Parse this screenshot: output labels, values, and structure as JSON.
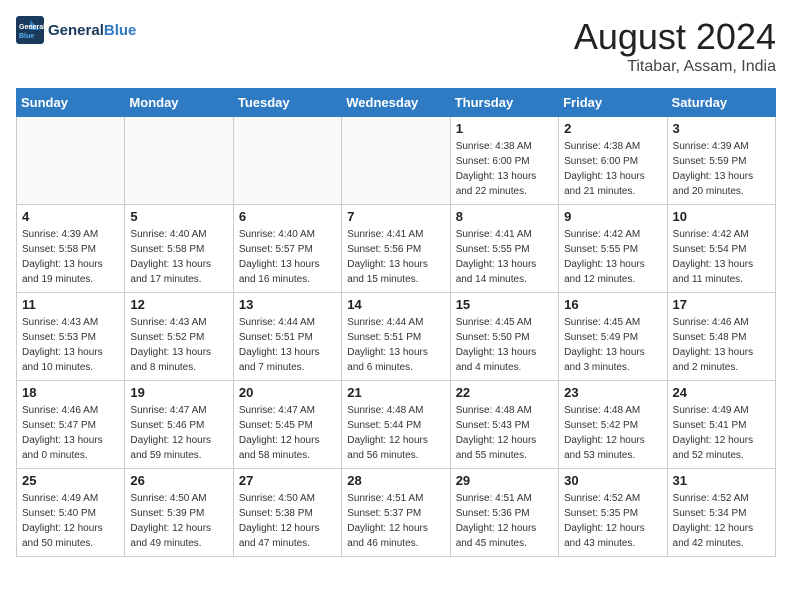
{
  "logo": {
    "line1": "General",
    "line2": "Blue"
  },
  "title": "August 2024",
  "location": "Titabar, Assam, India",
  "headers": [
    "Sunday",
    "Monday",
    "Tuesday",
    "Wednesday",
    "Thursday",
    "Friday",
    "Saturday"
  ],
  "weeks": [
    [
      {
        "day": "",
        "info": ""
      },
      {
        "day": "",
        "info": ""
      },
      {
        "day": "",
        "info": ""
      },
      {
        "day": "",
        "info": ""
      },
      {
        "day": "1",
        "info": "Sunrise: 4:38 AM\nSunset: 6:00 PM\nDaylight: 13 hours\nand 22 minutes."
      },
      {
        "day": "2",
        "info": "Sunrise: 4:38 AM\nSunset: 6:00 PM\nDaylight: 13 hours\nand 21 minutes."
      },
      {
        "day": "3",
        "info": "Sunrise: 4:39 AM\nSunset: 5:59 PM\nDaylight: 13 hours\nand 20 minutes."
      }
    ],
    [
      {
        "day": "4",
        "info": "Sunrise: 4:39 AM\nSunset: 5:58 PM\nDaylight: 13 hours\nand 19 minutes."
      },
      {
        "day": "5",
        "info": "Sunrise: 4:40 AM\nSunset: 5:58 PM\nDaylight: 13 hours\nand 17 minutes."
      },
      {
        "day": "6",
        "info": "Sunrise: 4:40 AM\nSunset: 5:57 PM\nDaylight: 13 hours\nand 16 minutes."
      },
      {
        "day": "7",
        "info": "Sunrise: 4:41 AM\nSunset: 5:56 PM\nDaylight: 13 hours\nand 15 minutes."
      },
      {
        "day": "8",
        "info": "Sunrise: 4:41 AM\nSunset: 5:55 PM\nDaylight: 13 hours\nand 14 minutes."
      },
      {
        "day": "9",
        "info": "Sunrise: 4:42 AM\nSunset: 5:55 PM\nDaylight: 13 hours\nand 12 minutes."
      },
      {
        "day": "10",
        "info": "Sunrise: 4:42 AM\nSunset: 5:54 PM\nDaylight: 13 hours\nand 11 minutes."
      }
    ],
    [
      {
        "day": "11",
        "info": "Sunrise: 4:43 AM\nSunset: 5:53 PM\nDaylight: 13 hours\nand 10 minutes."
      },
      {
        "day": "12",
        "info": "Sunrise: 4:43 AM\nSunset: 5:52 PM\nDaylight: 13 hours\nand 8 minutes."
      },
      {
        "day": "13",
        "info": "Sunrise: 4:44 AM\nSunset: 5:51 PM\nDaylight: 13 hours\nand 7 minutes."
      },
      {
        "day": "14",
        "info": "Sunrise: 4:44 AM\nSunset: 5:51 PM\nDaylight: 13 hours\nand 6 minutes."
      },
      {
        "day": "15",
        "info": "Sunrise: 4:45 AM\nSunset: 5:50 PM\nDaylight: 13 hours\nand 4 minutes."
      },
      {
        "day": "16",
        "info": "Sunrise: 4:45 AM\nSunset: 5:49 PM\nDaylight: 13 hours\nand 3 minutes."
      },
      {
        "day": "17",
        "info": "Sunrise: 4:46 AM\nSunset: 5:48 PM\nDaylight: 13 hours\nand 2 minutes."
      }
    ],
    [
      {
        "day": "18",
        "info": "Sunrise: 4:46 AM\nSunset: 5:47 PM\nDaylight: 13 hours\nand 0 minutes."
      },
      {
        "day": "19",
        "info": "Sunrise: 4:47 AM\nSunset: 5:46 PM\nDaylight: 12 hours\nand 59 minutes."
      },
      {
        "day": "20",
        "info": "Sunrise: 4:47 AM\nSunset: 5:45 PM\nDaylight: 12 hours\nand 58 minutes."
      },
      {
        "day": "21",
        "info": "Sunrise: 4:48 AM\nSunset: 5:44 PM\nDaylight: 12 hours\nand 56 minutes."
      },
      {
        "day": "22",
        "info": "Sunrise: 4:48 AM\nSunset: 5:43 PM\nDaylight: 12 hours\nand 55 minutes."
      },
      {
        "day": "23",
        "info": "Sunrise: 4:48 AM\nSunset: 5:42 PM\nDaylight: 12 hours\nand 53 minutes."
      },
      {
        "day": "24",
        "info": "Sunrise: 4:49 AM\nSunset: 5:41 PM\nDaylight: 12 hours\nand 52 minutes."
      }
    ],
    [
      {
        "day": "25",
        "info": "Sunrise: 4:49 AM\nSunset: 5:40 PM\nDaylight: 12 hours\nand 50 minutes."
      },
      {
        "day": "26",
        "info": "Sunrise: 4:50 AM\nSunset: 5:39 PM\nDaylight: 12 hours\nand 49 minutes."
      },
      {
        "day": "27",
        "info": "Sunrise: 4:50 AM\nSunset: 5:38 PM\nDaylight: 12 hours\nand 47 minutes."
      },
      {
        "day": "28",
        "info": "Sunrise: 4:51 AM\nSunset: 5:37 PM\nDaylight: 12 hours\nand 46 minutes."
      },
      {
        "day": "29",
        "info": "Sunrise: 4:51 AM\nSunset: 5:36 PM\nDaylight: 12 hours\nand 45 minutes."
      },
      {
        "day": "30",
        "info": "Sunrise: 4:52 AM\nSunset: 5:35 PM\nDaylight: 12 hours\nand 43 minutes."
      },
      {
        "day": "31",
        "info": "Sunrise: 4:52 AM\nSunset: 5:34 PM\nDaylight: 12 hours\nand 42 minutes."
      }
    ]
  ]
}
